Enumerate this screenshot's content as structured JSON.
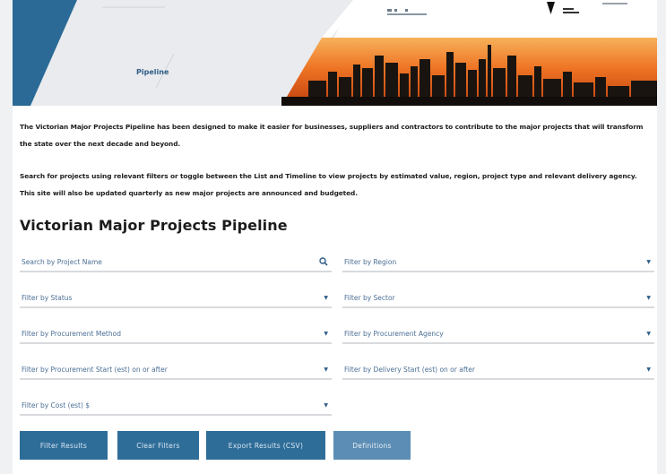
{
  "header": {
    "title": "Pipeline"
  },
  "intro": {
    "paragraph1": "The Victorian Major Projects Pipeline has been designed to make it easier for businesses, suppliers and contractors to contribute to the major projects that will transform the state over the next decade and beyond.",
    "paragraph2": "Search for projects using relevant filters or toggle between the List and Timeline to view projects by estimated value, region, project type and relevant delivery agency. This site will also be updated quarterly as new major projects are announced and budgeted."
  },
  "page_title": "Victorian Major Projects Pipeline",
  "filters": {
    "search_placeholder": "Search by Project Name",
    "region": "Filter by Region",
    "status": "Filter by Status",
    "sector": "Filter by Sector",
    "procurement_method": "Filter by Procurement Method",
    "procurement_agency": "Filter by Procurement Agency",
    "procurement_start": "Filter by Procurement Start (est) on or after",
    "delivery_start": "Filter by Delivery Start (est) on or after",
    "cost": "Filter by Cost (est) $"
  },
  "buttons": {
    "filter_results": "Filter Results",
    "clear_filters": "Clear Filters",
    "export_results": "Export Results (CSV)",
    "definitions": "Definitions"
  },
  "colors": {
    "accent": "#2f6d99",
    "accent_light": "#5c8db4",
    "banner_blue": "#2b6a96",
    "sunset_orange": "#e8681f",
    "placeholder_text": "#4b6f95"
  },
  "icons": {
    "search": "search-icon",
    "dropdown": "chevron-down-icon"
  }
}
